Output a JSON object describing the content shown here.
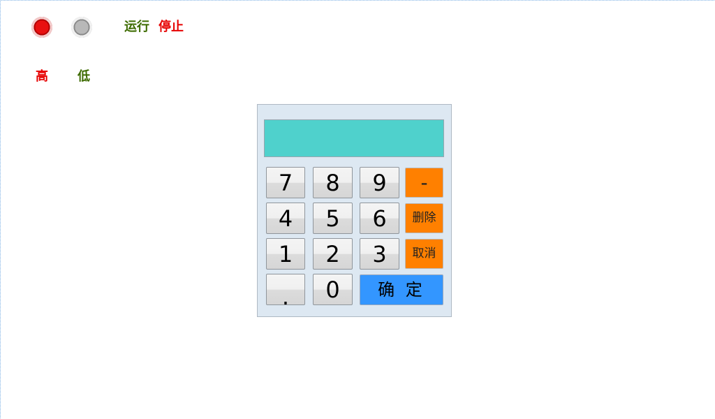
{
  "status": {
    "run_label": "运行",
    "stop_label": "停止",
    "high_label": "高",
    "low_label": "低"
  },
  "colors": {
    "run_lamp": "#d40000",
    "stop_lamp": "#b0b0b0",
    "display_bg": "#4fd1cc",
    "func_key": "#ff8000",
    "confirm_key": "#3396ff"
  },
  "keypad": {
    "display_value": "",
    "keys": {
      "k7": "7",
      "k8": "8",
      "k9": "9",
      "minus": "-",
      "k4": "4",
      "k5": "5",
      "k6": "6",
      "delete": "删除",
      "k1": "1",
      "k2": "2",
      "k3": "3",
      "cancel": "取消",
      "dot": ".",
      "k0": "0",
      "confirm": "确 定"
    }
  }
}
